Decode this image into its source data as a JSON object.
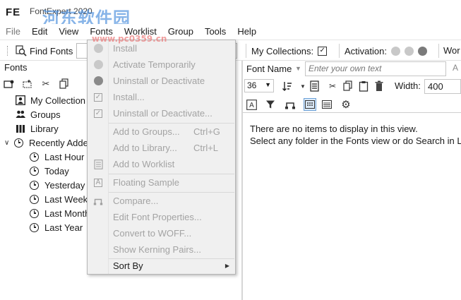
{
  "app": {
    "logo": "FE",
    "window_title": "FontExpert 2020",
    "watermark": "河东软件园",
    "watermark_url": "www.pc0359.cn"
  },
  "menubar": {
    "items": [
      "File",
      "Edit",
      "View",
      "Fonts",
      "Worklist",
      "Group",
      "Tools",
      "Help"
    ]
  },
  "toolbar": {
    "find_fonts": "Find Fonts",
    "my_collections": "My Collections:",
    "my_collections_checked": true,
    "activation": "Activation:",
    "activation_dots": [
      "#c8c8c8",
      "#c8c8c8",
      "#7a7a7a"
    ],
    "worklist_cut": "Wor"
  },
  "left_pane": {
    "title": "Fonts",
    "tree": [
      {
        "label": "My Collection",
        "icon": "person-icon",
        "indent": 0
      },
      {
        "label": "Groups",
        "icon": "people-icon",
        "indent": 0
      },
      {
        "label": "Library",
        "icon": "books-icon",
        "indent": 0
      },
      {
        "label": "Recently Adde",
        "icon": "clock-icon",
        "indent": 0,
        "expanded": true
      },
      {
        "label": "Last Hour",
        "icon": "clock-icon",
        "indent": 1
      },
      {
        "label": "Today",
        "icon": "clock-icon",
        "indent": 1
      },
      {
        "label": "Yesterday",
        "icon": "clock-icon",
        "indent": 1
      },
      {
        "label": "Last Week",
        "icon": "clock-icon",
        "indent": 1
      },
      {
        "label": "Last Month",
        "icon": "clock-icon",
        "indent": 1
      },
      {
        "label": "Last Year",
        "icon": "clock-icon",
        "indent": 1
      }
    ]
  },
  "right_pane": {
    "font_name_label": "Font Name",
    "own_text_placeholder": "Enter your own text",
    "size_value": "36",
    "width_label": "Width:",
    "width_value": "400",
    "empty_line1": "There are no items to display in this view.",
    "empty_line2": "Select any folder in the Fonts view or do Search in L"
  },
  "context_menu": {
    "items": [
      {
        "label": "Install",
        "shortcut": "",
        "icon": "circle-light"
      },
      {
        "label": "Activate Temporarily",
        "shortcut": "",
        "icon": "circle-light"
      },
      {
        "label": "Uninstall or Deactivate",
        "shortcut": "",
        "icon": "circle-dark"
      },
      {
        "label": "Install...",
        "shortcut": "",
        "icon": "check-box"
      },
      {
        "label": "Uninstall or Deactivate...",
        "shortcut": "",
        "icon": "check-box"
      },
      {
        "label": "Add to Groups...",
        "shortcut": "Ctrl+G",
        "icon": ""
      },
      {
        "label": "Add to Library...",
        "shortcut": "Ctrl+L",
        "icon": ""
      },
      {
        "label": "Add to Worklist",
        "shortcut": "",
        "icon": "list-box"
      },
      {
        "label": "Floating Sample",
        "shortcut": "",
        "icon": "letter-box"
      },
      {
        "label": "Compare...",
        "shortcut": "",
        "icon": "compare"
      },
      {
        "label": "Edit Font Properties...",
        "shortcut": "",
        "icon": ""
      },
      {
        "label": "Convert to WOFF...",
        "shortcut": "",
        "icon": ""
      },
      {
        "label": "Show Kerning Pairs...",
        "shortcut": "",
        "icon": ""
      },
      {
        "label": "Sort By",
        "shortcut": "",
        "icon": "",
        "enabled": true,
        "submenu": true
      }
    ]
  }
}
